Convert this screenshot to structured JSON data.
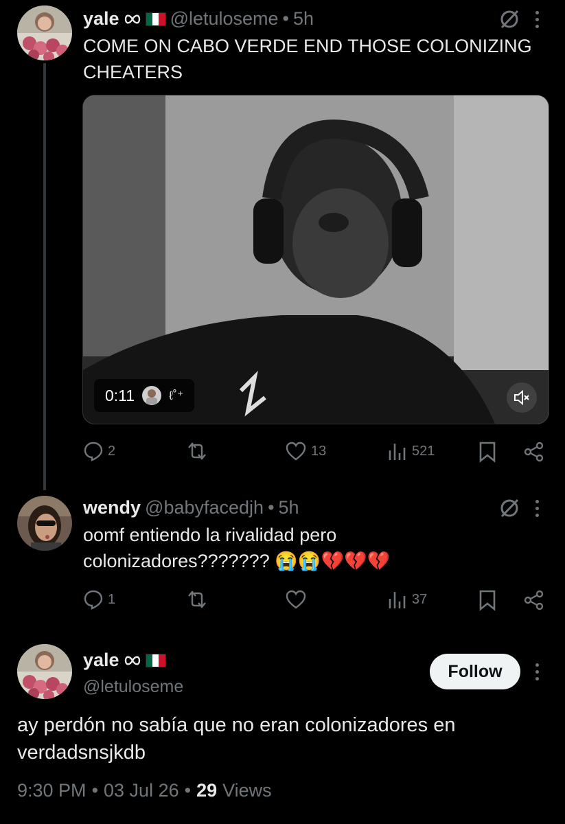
{
  "tweet1": {
    "name": "yale",
    "handle": "@letuloseme",
    "separator": "•",
    "time": "5h",
    "text_line1": "COME ON CABO VERDE END THOSE COLONIZING",
    "text_line2": "CHEATERS",
    "video": {
      "duration": "0:11",
      "overlay_glyph": "ℓ˚⁺"
    },
    "actions": {
      "replies": "2",
      "likes": "13",
      "views": "521"
    }
  },
  "reply": {
    "name": "wendy",
    "handle": "@babyfacedjh",
    "separator": "•",
    "time": "5h",
    "text_line1": "oomf entiendo la rivalidad pero",
    "text_line2": "colonizadores???????",
    "emojis": "😭😭💔💔💔",
    "actions": {
      "replies": "1",
      "views": "37"
    }
  },
  "main": {
    "name": "yale",
    "handle": "@letuloseme",
    "follow_label": "Follow",
    "text_line1": "ay perdón no sabía que no eran colonizadores en",
    "text_line2": "verdadsnsjkdb",
    "footer": {
      "time": "9:30 PM",
      "sep1": "•",
      "date": "03 Jul 26",
      "sep2": "•",
      "views_count": "29",
      "views_label": "Views"
    }
  },
  "colors": {
    "background": "#000000",
    "text": "#e7e9ea",
    "muted": "#71767b",
    "follow_bg": "#eff3f4"
  },
  "icons": [
    "infinity-icon",
    "mexico-flag-icon",
    "grok-icon",
    "more-icon",
    "reply-icon",
    "retweet-icon",
    "like-icon",
    "views-icon",
    "bookmark-icon",
    "share-icon",
    "mute-icon"
  ]
}
